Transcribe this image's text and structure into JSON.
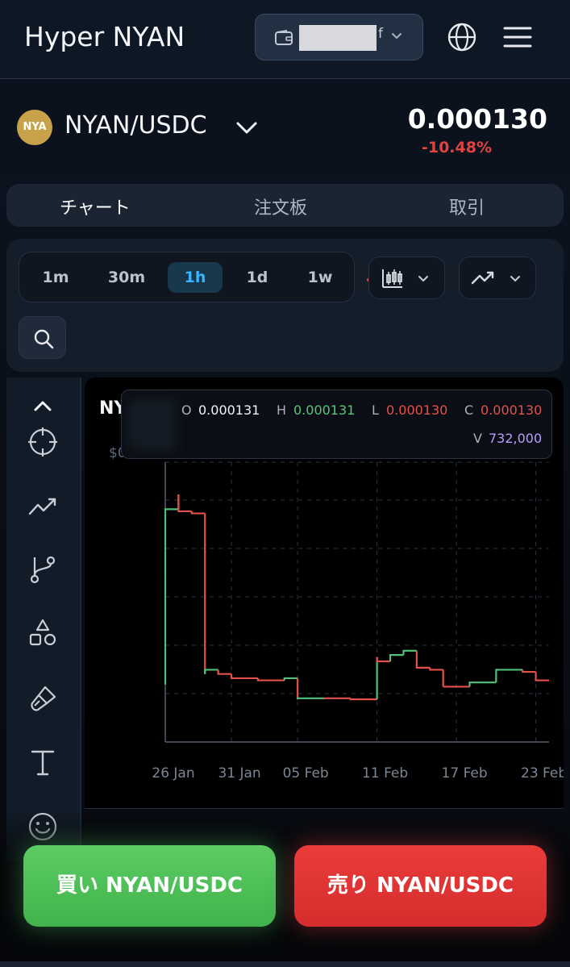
{
  "app": {
    "title": "Hyper NYAN"
  },
  "wallet": {
    "address_masked": "",
    "address_suffix": "f"
  },
  "pair": {
    "logo_text": "NYA",
    "name": "NYAN/USDC",
    "price": "0.000130",
    "change": "-10.48%"
  },
  "tabs": [
    {
      "label": "チャート",
      "active": true
    },
    {
      "label": "注文板",
      "active": false
    },
    {
      "label": "取引",
      "active": false
    }
  ],
  "intervals": [
    {
      "label": "1m",
      "active": false
    },
    {
      "label": "30m",
      "active": false
    },
    {
      "label": "1h",
      "active": true
    },
    {
      "label": "1d",
      "active": false
    },
    {
      "label": "1w",
      "active": false
    }
  ],
  "chart": {
    "ticker": "NY",
    "axis_prefix": "$0",
    "ohlc": {
      "o_label": "O",
      "o": "0.000131",
      "h_label": "H",
      "h": "0.000131",
      "l_label": "L",
      "l": "0.000130",
      "c_label": "C",
      "c": "0.000130",
      "v_label": "V",
      "v": "732,000"
    }
  },
  "chart_data": {
    "type": "line",
    "x_labels": [
      "26 Jan",
      "31 Jan",
      "05 Feb",
      "11 Feb",
      "17 Feb",
      "23 Feb"
    ],
    "series_color_up": "#4fbf7a",
    "series_color_down": "#e4514a",
    "points": [
      [
        "26 Jan",
        0.1
      ],
      [
        "26 Jan",
        0.6
      ],
      [
        "27 Jan",
        0.93
      ],
      [
        "27 Jan",
        1.0
      ],
      [
        "28 Jan",
        0.92
      ],
      [
        "29 Jan",
        0.91
      ],
      [
        "29 Jan",
        0.4
      ],
      [
        "29 Jan",
        0.15
      ],
      [
        "30 Jan",
        0.17
      ],
      [
        "31 Jan",
        0.15
      ],
      [
        "02 Feb",
        0.13
      ],
      [
        "04 Feb",
        0.12
      ],
      [
        "05 Feb",
        0.13
      ],
      [
        "05 Feb",
        0.03
      ],
      [
        "07 Feb",
        0.035
      ],
      [
        "09 Feb",
        0.035
      ],
      [
        "11 Feb",
        0.03
      ],
      [
        "11 Feb",
        0.23
      ],
      [
        "12 Feb",
        0.21
      ],
      [
        "13 Feb",
        0.24
      ],
      [
        "14 Feb",
        0.26
      ],
      [
        "15 Feb",
        0.18
      ],
      [
        "16 Feb",
        0.17
      ],
      [
        "16 Feb",
        0.09
      ],
      [
        "18 Feb",
        0.09
      ],
      [
        "20 Feb",
        0.11
      ],
      [
        "22 Feb",
        0.17
      ],
      [
        "23 Feb",
        0.16
      ],
      [
        "24 Feb",
        0.12
      ]
    ]
  },
  "actions": {
    "buy": "買い NYAN/USDC",
    "sell": "売り NYAN/USDC"
  },
  "colors": {
    "buy": "#4fc55a",
    "sell": "#e03a38",
    "accent": "#35b6ff",
    "negative": "#e0443f"
  }
}
